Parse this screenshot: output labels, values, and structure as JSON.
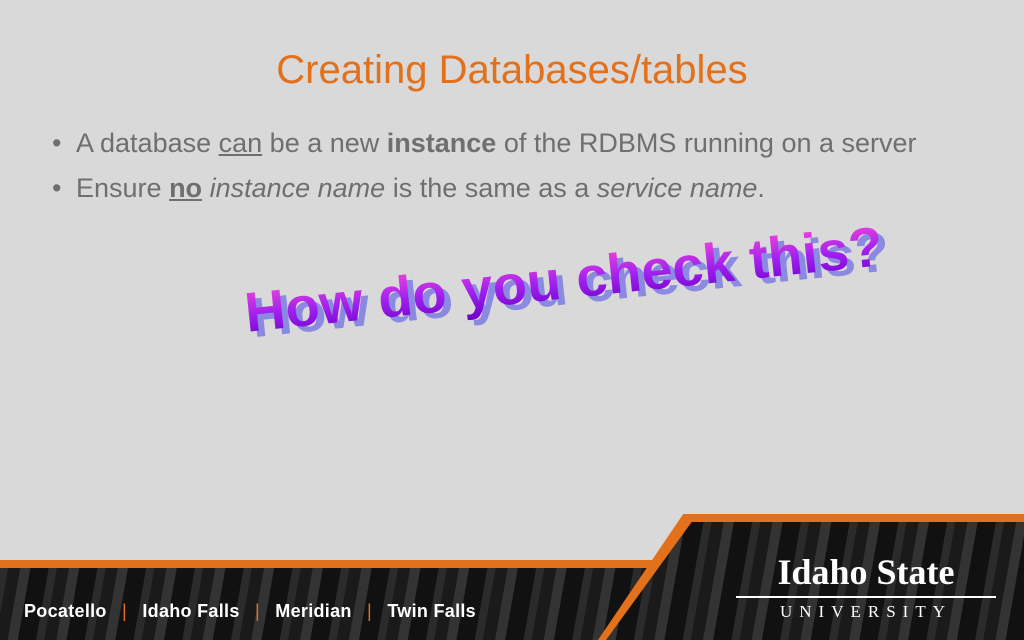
{
  "title": "Creating Databases/tables",
  "b1": {
    "p1": "A database ",
    "p2_u": "can",
    "p3": " be a new ",
    "p4_b": "instance",
    "p5": " of the RDBMS running on a server"
  },
  "b2": {
    "p1": "Ensure ",
    "p2_bu": "no",
    "p3": " ",
    "p4_i": "instance name",
    "p5": " is the same as a ",
    "p6_i": "service name",
    "p7": "."
  },
  "callout": "How do you check this?",
  "campuses": {
    "c1": "Pocatello",
    "c2": "Idaho Falls",
    "c3": "Meridian",
    "c4": "Twin Falls"
  },
  "logo": {
    "line1": "Idaho State",
    "line2": "UNIVERSITY"
  }
}
